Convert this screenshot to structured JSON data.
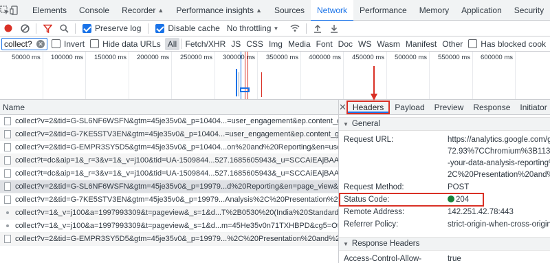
{
  "tabbar": {
    "tabs": [
      {
        "label": "Elements"
      },
      {
        "label": "Console"
      },
      {
        "label": "Recorder"
      },
      {
        "label": "Performance insights"
      },
      {
        "label": "Sources"
      },
      {
        "label": "Network"
      },
      {
        "label": "Performance"
      },
      {
        "label": "Memory"
      },
      {
        "label": "Application"
      },
      {
        "label": "Security"
      }
    ],
    "active_tab": "Network",
    "icons": [
      "inspect-element-icon",
      "device-toolbar-icon"
    ]
  },
  "toolbar": {
    "preserve_log": "Preserve log",
    "disable_cache": "Disable cache",
    "throttling": "No throttling",
    "preserve_log_checked": true,
    "disable_cache_checked": true
  },
  "filter": {
    "value": "collect?",
    "invert": "Invert",
    "hide_data_urls": "Hide data URLs",
    "types": [
      "All",
      "Fetch/XHR",
      "JS",
      "CSS",
      "Img",
      "Media",
      "Font",
      "Doc",
      "WS",
      "Wasm",
      "Manifest",
      "Other"
    ],
    "has_blocked_cookies": "Has blocked cook"
  },
  "overview": {
    "ticks": [
      "50000 ms",
      "100000 ms",
      "150000 ms",
      "200000 ms",
      "250000 ms",
      "300000 ms",
      "350000 ms",
      "400000 ms",
      "450000 ms",
      "500000 ms",
      "550000 ms",
      "600000 ms"
    ]
  },
  "requests": {
    "column": "Name",
    "rows": [
      {
        "name": "collect?v=2&tid=G-SL6NF6WSFN&gtm=45je35v0&_p=10404...=user_engagement&ep.content_gr..."
      },
      {
        "name": "collect?v=2&tid=G-7KE5STV3EN&gtm=45je35v0&_p=10404...=user_engagement&ep.content_gr..."
      },
      {
        "name": "collect?v=2&tid=G-EMPR3SY5D5&gtm=45je35v0&_p=10404...on%20and%20Reporting&en=user..."
      },
      {
        "name": "collect?t=dc&aip=1&_r=3&v=1&_v=j100&tid=UA-1509844...527.1685605943&_u=SCCAiEAjBAAA..."
      },
      {
        "name": "collect?t=dc&aip=1&_r=3&v=1&_v=j100&tid=UA-1509844...527.1685605943&_u=SCCAiEAjBAAA..."
      },
      {
        "name": "collect?v=2&tid=G-SL6NF6WSFN&gtm=45je35v0&_p=19979...d%20Reporting&en=page_view&e..."
      },
      {
        "name": "collect?v=2&tid=G-7KE5STV3EN&gtm=45je35v0&_p=19979...Analysis%2C%20Presentation%20a..."
      },
      {
        "name": "collect?v=1&_v=j100&a=1997993309&t=pageview&_s=1&d...T%2B0530%20(India%20Standard%..."
      },
      {
        "name": "collect?v=1&_v=j100&a=1997993309&t=pageview&_s=1&d...m=45He35v0n71TXHBPD&cg5=Ot..."
      },
      {
        "name": "collect?v=2&tid=G-EMPR3SY5D5&gtm=45je35v0&_p=19979...%2C%20Presentation%20and%20R..."
      }
    ]
  },
  "details": {
    "tabs": [
      "Headers",
      "Payload",
      "Preview",
      "Response",
      "Initiator"
    ],
    "active_tab": "Headers",
    "general": {
      "title": "General",
      "request_url_label": "Request URL:",
      "request_url_lines": [
        "https://analytics.google.com/g/c",
        "72.93%7CChromium%3B113.0.5",
        "-your-data-analysis-reporting%2",
        "2C%20Presentation%20and%20R"
      ],
      "request_method_label": "Request Method:",
      "request_method": "POST",
      "status_code_label": "Status Code:",
      "status_code": "204",
      "remote_address_label": "Remote Address:",
      "remote_address": "142.251.42.78:443",
      "referrer_policy_label": "Referrer Policy:",
      "referrer_policy": "strict-origin-when-cross-origin"
    },
    "response_headers": {
      "title": "Response Headers",
      "first_label": "Access-Control-Allow-",
      "first_value": "true"
    }
  },
  "colors": {
    "accent": "#1a73e8",
    "annotation": "#d93025",
    "status_ok": "#188038"
  }
}
